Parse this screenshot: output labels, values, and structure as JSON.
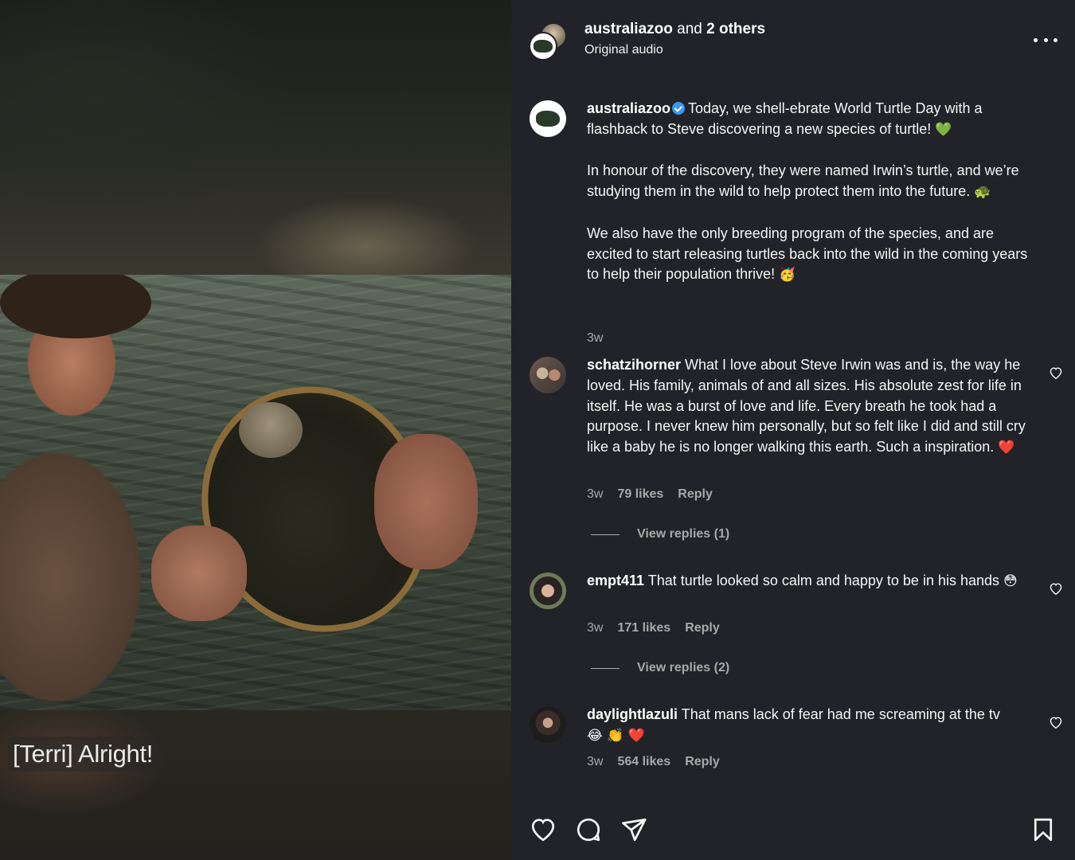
{
  "media": {
    "caption": "[Terri] Alright!"
  },
  "header": {
    "author": "australiazoo",
    "connector": "and",
    "others": "2 others",
    "audio": "Original audio"
  },
  "caption_post": {
    "username": "australiazoo",
    "verified": true,
    "p1": "Today, we shell-ebrate World Turtle Day with a flashback to Steve discovering a new species of turtle!",
    "p1_emoji": "💚",
    "p2": "In honour of the discovery, they were named Irwin’s turtle, and we’re studying them in the wild to help protect them into the future.",
    "p2_emoji": "🐢",
    "p3": "We also have the only breeding program of the species, and are excited to start releasing turtles back into the wild in the coming years to help their population thrive!",
    "p3_emoji": "🥳",
    "time": "3w"
  },
  "comments": [
    {
      "username": "schatzihorner",
      "text": "What I love about Steve Irwin was and is, the way he loved. His family, animals of and all sizes. His absolute zest for life in itself. He was a burst of love and life. Every breath he took had a purpose. I never knew him personally, but so felt like I did and still cry like a baby he is no longer walking this earth. Such a inspiration.",
      "emoji": "❤️",
      "time": "3w",
      "likes": "79 likes",
      "reply": "Reply",
      "view_replies": "View replies (1)"
    },
    {
      "username": "empt411",
      "text": "That turtle looked so calm and happy to be in his hands",
      "emoji": "😳",
      "time": "3w",
      "likes": "171 likes",
      "reply": "Reply",
      "view_replies": "View replies (2)"
    },
    {
      "username": "daylightlazuli",
      "text": "That mans lack of fear had me screaming at the tv",
      "emoji": "😂 👏 ❤️",
      "time": "3w",
      "likes": "564 likes",
      "reply": "Reply"
    }
  ],
  "icons": {
    "like": "heart-icon",
    "comment": "comment-icon",
    "share": "share-icon",
    "save": "bookmark-icon",
    "more": "more-icon"
  },
  "colors": {
    "panel_bg": "#212328",
    "text": "#f5f5f5",
    "muted": "#a8a8a8",
    "verified": "#3897f0"
  }
}
